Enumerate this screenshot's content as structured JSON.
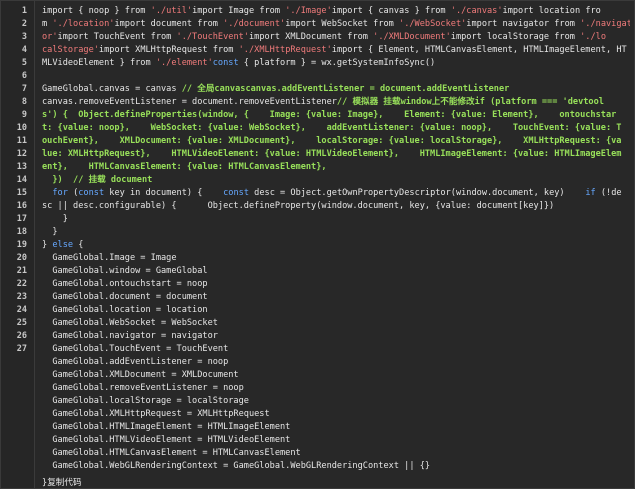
{
  "line_numbers": [
    "1",
    "2",
    "3",
    "4",
    "5",
    "6",
    "7",
    "8",
    "9",
    "10",
    "11",
    "12",
    "13",
    "14",
    "15",
    "16",
    "17",
    "18",
    "19",
    "20",
    "21",
    "22",
    "23",
    "24",
    "25",
    "26",
    "27"
  ],
  "code_lines": [
    [
      {
        "t": "import { noop } from ",
        "c": ""
      },
      {
        "t": "'./util'",
        "c": "s"
      },
      {
        "t": "import Image from ",
        "c": ""
      },
      {
        "t": "'./Image'",
        "c": "s"
      },
      {
        "t": "import { canvas } from ",
        "c": ""
      },
      {
        "t": "'./canvas'",
        "c": "s"
      },
      {
        "t": "import location fro",
        "c": ""
      }
    ],
    [
      {
        "t": "m ",
        "c": ""
      },
      {
        "t": "'./location'",
        "c": "s"
      },
      {
        "t": "import document from ",
        "c": ""
      },
      {
        "t": "'./document'",
        "c": "s"
      },
      {
        "t": "import WebSocket from ",
        "c": ""
      },
      {
        "t": "'./WebSocket'",
        "c": "s"
      },
      {
        "t": "import navigator from ",
        "c": ""
      },
      {
        "t": "'./navigat",
        "c": "s"
      }
    ],
    [
      {
        "t": "or'",
        "c": "s"
      },
      {
        "t": "import TouchEvent from ",
        "c": ""
      },
      {
        "t": "'./TouchEvent'",
        "c": "s"
      },
      {
        "t": "import XMLDocument from ",
        "c": ""
      },
      {
        "t": "'./XMLDocument'",
        "c": "s"
      },
      {
        "t": "import localStorage from ",
        "c": ""
      },
      {
        "t": "'./lo",
        "c": "s"
      }
    ],
    [
      {
        "t": "calStorage'",
        "c": "s"
      },
      {
        "t": "import XMLHttpRequest from ",
        "c": ""
      },
      {
        "t": "'./XMLHttpRequest'",
        "c": "s"
      },
      {
        "t": "import { Element, HTMLCanvasElement, HTMLImageElement, HT",
        "c": ""
      }
    ],
    [
      {
        "t": "MLVideoElement } from ",
        "c": ""
      },
      {
        "t": "'./element'",
        "c": "s"
      },
      {
        "t": "const",
        "c": "k"
      },
      {
        "t": " { platform } = wx.getSystemInfoSync()",
        "c": ""
      }
    ],
    [
      {
        "t": "",
        "c": ""
      }
    ],
    [
      {
        "t": "GameGlobal.canvas = canvas ",
        "c": ""
      },
      {
        "t": "// 全局canvascanvas.addEventListener = document.addEventListener",
        "c": "g"
      }
    ],
    [
      {
        "t": "canvas.removeEventListener = document.removeEventListener",
        "c": ""
      },
      {
        "t": "// 模拟器 挂载window上不能修改if (platform === 'devtool",
        "c": "g"
      }
    ],
    [
      {
        "t": "s') {  Object.defineProperties(window, {    Image: {value: Image},    Element: {value: Element},    ontouchstar",
        "c": "g"
      }
    ],
    [
      {
        "t": "t: {value: noop},    WebSocket: {value: WebSocket},    addEventListener: {value: noop},    TouchEvent: {value: T",
        "c": "g"
      }
    ],
    [
      {
        "t": "ouchEvent},    XMLDocument: {value: XMLDocument},    localStorage: {value: localStorage},    XMLHttpRequest: {va",
        "c": "g"
      }
    ],
    [
      {
        "t": "lue: XMLHttpRequest},    HTMLVideoElement: {value: HTMLVideoElement},    HTMLImageElement: {value: HTMLImageElem",
        "c": "g"
      }
    ],
    [
      {
        "t": "ent},    HTMLCanvasElement: {value: HTMLCanvasElement},",
        "c": "g"
      }
    ],
    [
      {
        "t": "  })  // 挂载 document",
        "c": "g"
      }
    ],
    [
      {
        "t": "  ",
        "c": ""
      },
      {
        "t": "for",
        "c": "k"
      },
      {
        "t": " (",
        "c": ""
      },
      {
        "t": "const",
        "c": "k"
      },
      {
        "t": " key in document) {    ",
        "c": ""
      },
      {
        "t": "const",
        "c": "k"
      },
      {
        "t": " desc = Object.getOwnPropertyDescriptor(window.document, key)    ",
        "c": ""
      },
      {
        "t": "if",
        "c": "k"
      },
      {
        "t": " (!de",
        "c": ""
      }
    ],
    [
      {
        "t": "sc || desc.configurable) {      Object.defineProperty(window.document, key, {value: document[key]})",
        "c": ""
      }
    ],
    [
      {
        "t": "    }",
        "c": ""
      }
    ],
    [
      {
        "t": "  }",
        "c": ""
      }
    ],
    [
      {
        "t": "} ",
        "c": ""
      },
      {
        "t": "else",
        "c": "k"
      },
      {
        "t": " {",
        "c": ""
      }
    ],
    [
      {
        "t": "  GameGlobal.Image = Image",
        "c": ""
      }
    ],
    [
      {
        "t": "  GameGlobal.window = GameGlobal",
        "c": ""
      }
    ],
    [
      {
        "t": "  GameGlobal.ontouchstart = noop",
        "c": ""
      }
    ],
    [
      {
        "t": "  GameGlobal.document = document",
        "c": ""
      }
    ],
    [
      {
        "t": "  GameGlobal.location = location",
        "c": ""
      }
    ],
    [
      {
        "t": "  GameGlobal.WebSocket = WebSocket",
        "c": ""
      }
    ],
    [
      {
        "t": "  GameGlobal.navigator = navigator",
        "c": ""
      }
    ],
    [
      {
        "t": "  GameGlobal.TouchEvent = TouchEvent",
        "c": ""
      }
    ],
    [
      {
        "t": "  GameGlobal.addEventListener = noop",
        "c": ""
      }
    ],
    [
      {
        "t": "  GameGlobal.XMLDocument = XMLDocument",
        "c": ""
      }
    ],
    [
      {
        "t": "  GameGlobal.removeEventListener = noop",
        "c": ""
      }
    ],
    [
      {
        "t": "  GameGlobal.localStorage = localStorage",
        "c": ""
      }
    ],
    [
      {
        "t": "  GameGlobal.XMLHttpRequest = XMLHttpRequest",
        "c": ""
      }
    ],
    [
      {
        "t": "  GameGlobal.HTMLImageElement = HTMLImageElement",
        "c": ""
      }
    ],
    [
      {
        "t": "  GameGlobal.HTMLVideoElement = HTMLVideoElement",
        "c": ""
      }
    ],
    [
      {
        "t": "  GameGlobal.HTMLCanvasElement = HTMLCanvasElement",
        "c": ""
      }
    ],
    [
      {
        "t": "  GameGlobal.WebGLRenderingContext = GameGlobal.WebGLRenderingContext || {}",
        "c": ""
      }
    ]
  ],
  "footer": {
    "closing": "}",
    "copy_label": "复制代码"
  },
  "colors": {
    "background": "#282828",
    "gutter": "#262626",
    "text": "#e6e6e6",
    "string": "#f07b7b",
    "keyword": "#66a8ff",
    "comment": "#98e05a"
  }
}
